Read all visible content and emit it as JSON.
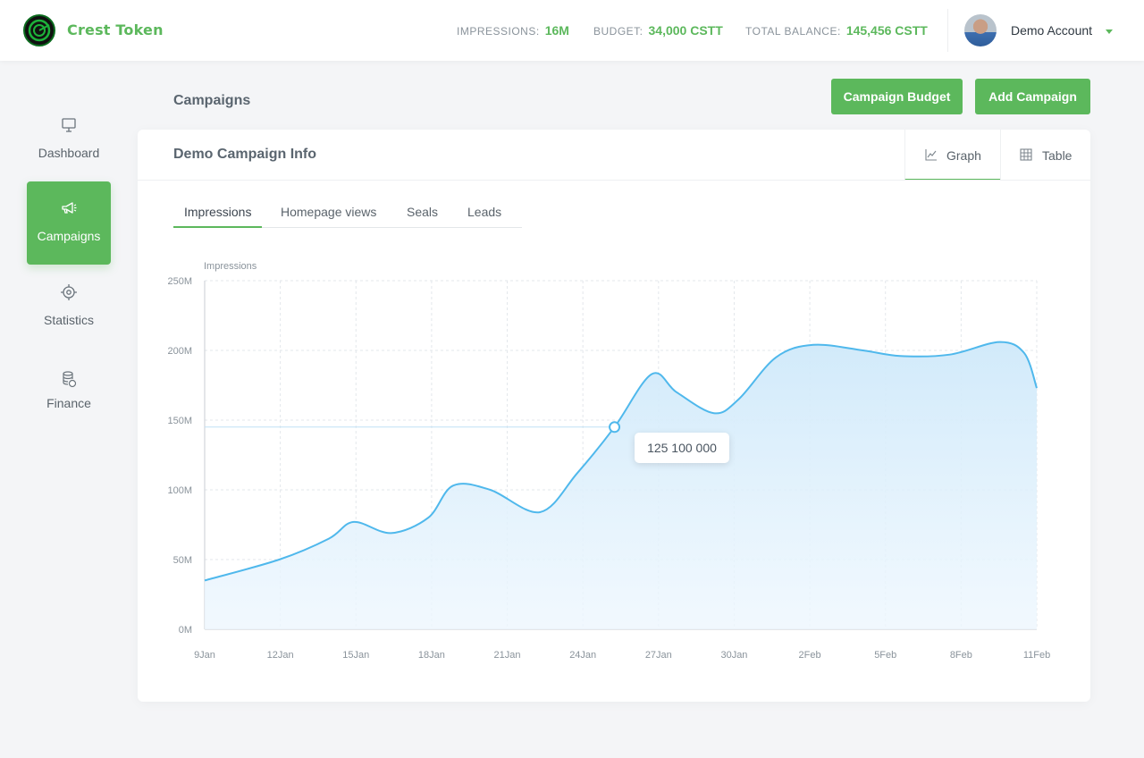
{
  "header": {
    "brand": "Crest Token",
    "stats": [
      {
        "label": "IMPRESSIONS:",
        "value": "16M"
      },
      {
        "label": "BUDGET:",
        "value": "34,000 CSTT"
      },
      {
        "label": "TOTAL BALANCE:",
        "value": "145,456 CSTT"
      }
    ],
    "account": "Demo Account"
  },
  "sidebar": {
    "items": [
      {
        "label": "Dashboard",
        "icon": "monitor-icon",
        "active": false
      },
      {
        "label": "Campaigns",
        "icon": "megaphone-icon",
        "active": true
      },
      {
        "label": "Statistics",
        "icon": "target-icon",
        "active": false
      },
      {
        "label": "Finance",
        "icon": "coins-icon",
        "active": false
      }
    ]
  },
  "page": {
    "title": "Campaigns",
    "buttons": {
      "budget": "Campaign Budget",
      "add": "Add Campaign"
    }
  },
  "card": {
    "title": "Demo Campaign Info",
    "views": [
      {
        "label": "Graph",
        "icon": "line-chart-icon",
        "active": true
      },
      {
        "label": "Table",
        "icon": "table-icon",
        "active": false
      }
    ],
    "metric_tabs": [
      {
        "label": "Impressions",
        "active": true
      },
      {
        "label": "Homepage views",
        "active": false
      },
      {
        "label": "Seals",
        "active": false
      },
      {
        "label": "Leads",
        "active": false
      }
    ],
    "tooltip": "125 100 000"
  },
  "colors": {
    "accent": "#5cb85c",
    "line": "#4fb8ec",
    "fill": "#d6ecfa"
  },
  "chart_data": {
    "type": "area",
    "ylabel": "Impressions",
    "ylim": [
      0,
      250
    ],
    "yticks": [
      "0M",
      "50M",
      "100M",
      "150M",
      "200M",
      "250M"
    ],
    "xticks": [
      "9Jan",
      "12Jan",
      "15Jan",
      "18Jan",
      "21Jan",
      "24Jan",
      "27Jan",
      "30Jan",
      "2Feb",
      "5Feb",
      "8Feb",
      "11Feb"
    ],
    "x": [
      9,
      12,
      14,
      15,
      16.5,
      18,
      19,
      20.5,
      22.5,
      24,
      25.5,
      27,
      28,
      29.5,
      30.5,
      32,
      33.5,
      35.5,
      37,
      39,
      41,
      42,
      42.5
    ],
    "y": [
      35,
      50,
      65,
      77,
      69,
      80,
      103,
      100,
      84,
      112,
      145,
      183,
      170,
      155,
      165,
      195,
      204,
      200,
      196,
      197,
      206,
      198,
      173
    ],
    "highlight": {
      "x": 25.5,
      "label": "125 100 000"
    },
    "grid": true,
    "legend": "none"
  }
}
